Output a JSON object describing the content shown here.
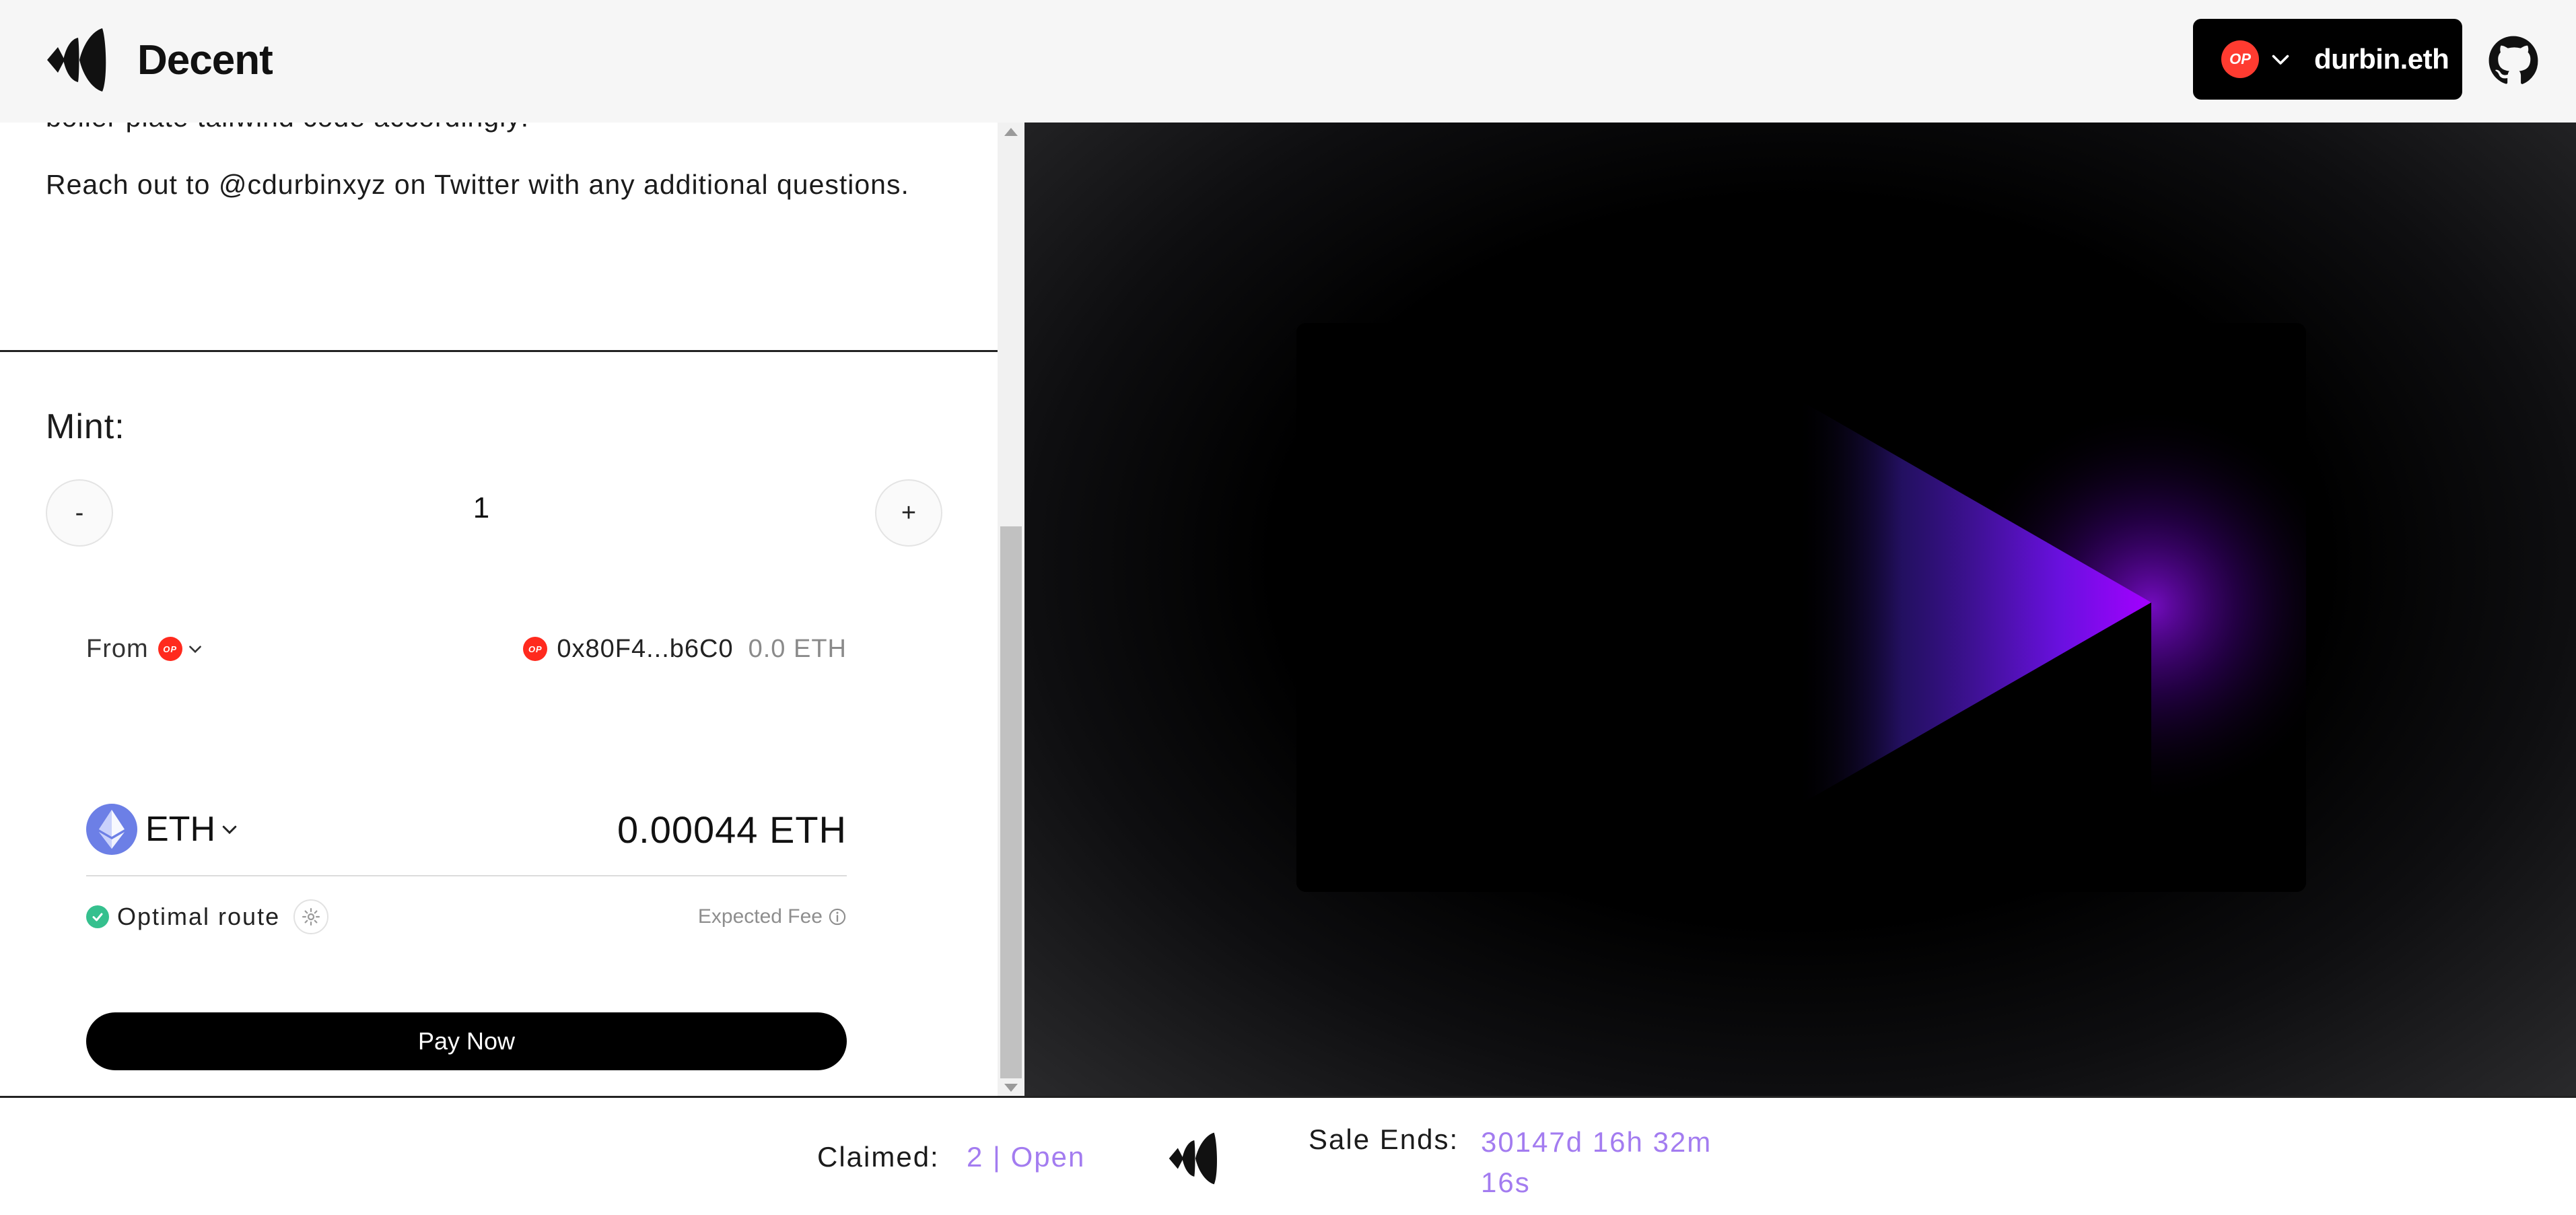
{
  "header": {
    "brand_name": "Decent",
    "network_badge": "OP",
    "wallet_name": "durbin.eth",
    "logo_icon": "decent-logo-icon",
    "github_icon": "github-icon"
  },
  "description": {
    "partial_line": "boiler plate tailwind code accordingly!",
    "contact": "Reach out to @cdurbinxyz on Twitter with any additional questions."
  },
  "mint": {
    "label": "Mint:",
    "decrement": "-",
    "increment": "+",
    "quantity": "1"
  },
  "payment": {
    "from_label": "From",
    "from_network": "OP",
    "address": "0x80F4...b6C0",
    "balance": "0.0 ETH",
    "token": "ETH",
    "amount": "0.00044 ETH",
    "route_label": "Optimal route",
    "fee_label": "Expected Fee",
    "pay_label": "Pay Now"
  },
  "footer": {
    "claimed_label": "Claimed:",
    "claimed_value": "2 | Open",
    "sale_label": "Sale Ends:",
    "sale_value": "30147d 16h 32m 16s"
  },
  "colors": {
    "accent_purple": "#a37cf0",
    "op_red": "#ff3b30",
    "eth_blue": "#6c7fe6",
    "route_green": "#35c08e",
    "preview_glow": "#8a00ff"
  }
}
